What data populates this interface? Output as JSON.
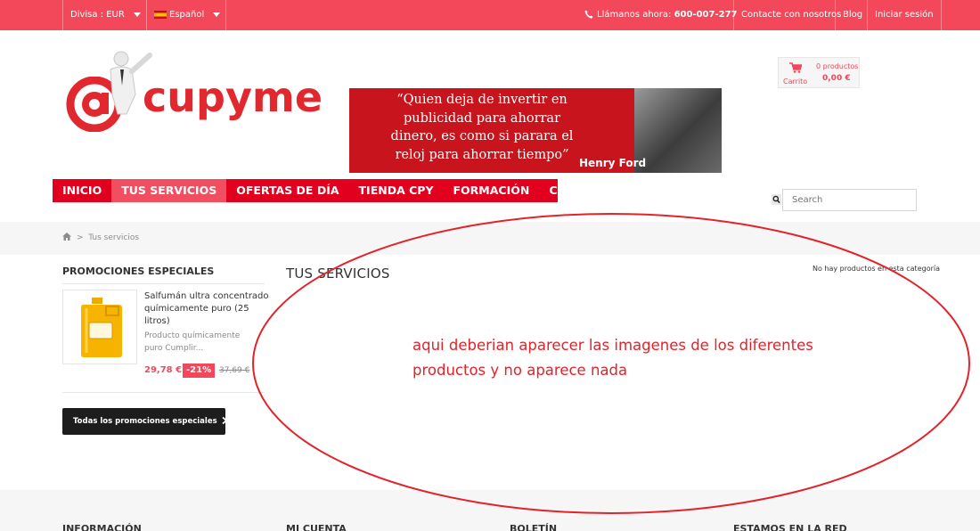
{
  "topbar": {
    "currency": "Divisa : EUR",
    "language": "Español",
    "call_label": "Llámanos ahora:",
    "phone": "600-007-277",
    "contact": "Contacte con nosotros",
    "blog": "Blog",
    "login": "Iniciar sesión"
  },
  "logo": {
    "text": "cupyme",
    "at": "@"
  },
  "banner": {
    "quote": "“Quien deja de invertir en publicidad para ahorrar dinero, es como si parara el reloj para ahorrar tiempo”",
    "author": "Henry Ford"
  },
  "cart": {
    "label": "Carrito",
    "count": "0 productos",
    "total": "0,00 €"
  },
  "nav": {
    "items": [
      "INICIO",
      "TUS SERVICIOS",
      "OFERTAS DE DÍA",
      "TIENDA CPY",
      "FORMACIÓN",
      "CUPYME"
    ]
  },
  "search": {
    "placeholder": "Search"
  },
  "breadcrumb": {
    "separator": ">",
    "current": "Tus servicios"
  },
  "sidebar": {
    "title": "PROMOCIONES ESPECIALES",
    "product": {
      "name": "Salfumán ultra concentrado químicamente puro (25 litros)",
      "description": "Producto químicamente puro Cumplir...",
      "price": "29,78 €",
      "discount": "-21%",
      "old_price": "37,69 €"
    },
    "button": "Todas los promociones especiales"
  },
  "main": {
    "title": "TUS SERVICIOS",
    "empty_message": "No hay productos en esta categoría",
    "annotation": "aqui deberian aparecer las imagenes de los diferentes productos y no aparece nada"
  },
  "footer": {
    "columns": [
      "INFORMACIÓN",
      "MI CUENTA",
      "BOLETÍN",
      "ESTAMOS EN LA RED"
    ]
  },
  "colors": {
    "brand": "#f3475a",
    "nav": "#e1001e",
    "annotation": "#e2232a"
  }
}
